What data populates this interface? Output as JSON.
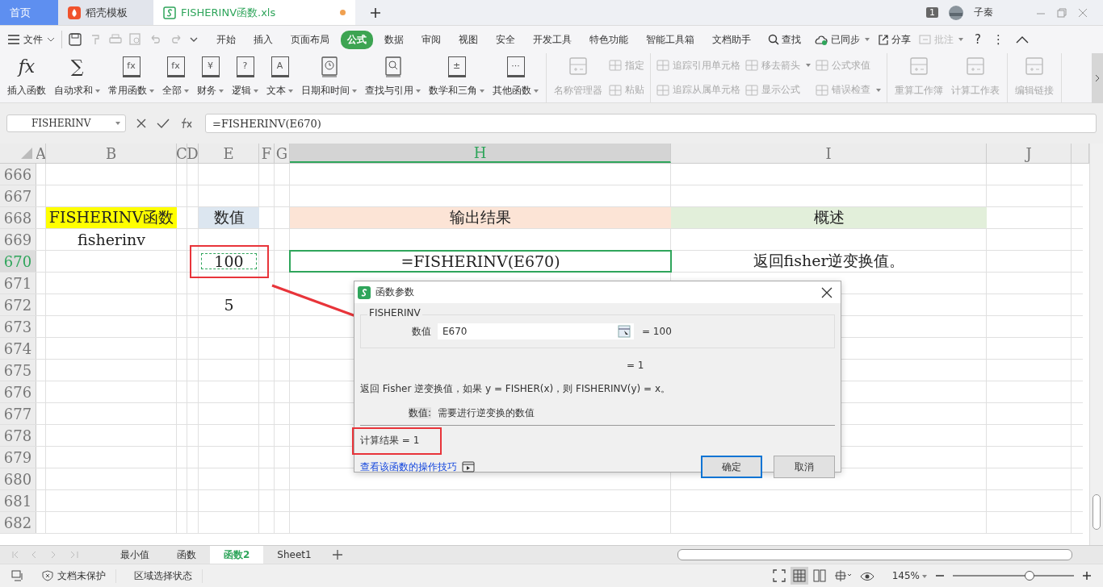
{
  "tabs": [
    {
      "label": "首页",
      "kind": "home",
      "selected": false,
      "modified": false
    },
    {
      "label": "稻壳模板",
      "kind": "docer",
      "selected": false,
      "modified": false
    },
    {
      "label": "FISHERINV函数.xls",
      "kind": "sheet",
      "selected": true,
      "modified": true
    }
  ],
  "title_bar": {
    "badge": "1",
    "user": "子秦"
  },
  "menu": {
    "file": "文件",
    "items": [
      {
        "label": "开始",
        "selected": false
      },
      {
        "label": "插入",
        "selected": false
      },
      {
        "label": "页面布局",
        "selected": false
      },
      {
        "label": "公式",
        "selected": true
      },
      {
        "label": "数据",
        "selected": false
      },
      {
        "label": "审阅",
        "selected": false
      },
      {
        "label": "视图",
        "selected": false
      },
      {
        "label": "安全",
        "selected": false
      },
      {
        "label": "开发工具",
        "selected": false
      },
      {
        "label": "特色功能",
        "selected": false
      },
      {
        "label": "智能工具箱",
        "selected": false
      },
      {
        "label": "文档助手",
        "selected": false
      }
    ],
    "search": "查找",
    "sync": "已同步",
    "share": "分享",
    "comment": {
      "label": "批注",
      "disabled": true
    },
    "help": "?",
    "more": "⋮"
  },
  "ribbon": [
    [
      {
        "kind": "glyph",
        "glyph": "fx",
        "label": "插入函数",
        "dropdown": false,
        "disabled": false
      },
      {
        "kind": "glyph",
        "glyph": "∑",
        "label": "自动求和",
        "dropdown": true,
        "disabled": false
      },
      {
        "kind": "boxed",
        "glyph": "fx",
        "label": "常用函数",
        "dropdown": true,
        "disabled": false
      },
      {
        "kind": "boxed",
        "glyph": "fx",
        "label": "全部",
        "dropdown": true,
        "disabled": false
      },
      {
        "kind": "boxed",
        "glyph": "¥",
        "label": "财务",
        "dropdown": true,
        "disabled": false
      },
      {
        "kind": "boxed",
        "glyph": "?",
        "label": "逻辑",
        "dropdown": true,
        "disabled": false
      },
      {
        "kind": "boxed",
        "glyph": "A",
        "label": "文本",
        "dropdown": true,
        "disabled": false
      },
      {
        "kind": "clock",
        "label": "日期和时间",
        "dropdown": true,
        "disabled": false
      },
      {
        "kind": "search",
        "label": "查找与引用",
        "dropdown": true,
        "disabled": false
      },
      {
        "kind": "boxed",
        "glyph": "±",
        "label": "数学和三角",
        "dropdown": true,
        "disabled": false
      },
      {
        "kind": "boxed",
        "glyph": "···",
        "label": "其他函数",
        "dropdown": true,
        "disabled": false
      }
    ],
    [
      {
        "kind": "drawn",
        "label": "名称管理器",
        "dropdown": false,
        "disabled": true
      },
      {
        "kind": "stack",
        "items": [
          {
            "label": "指定",
            "dropdown": false,
            "disabled": true
          },
          {
            "label": "粘贴",
            "dropdown": false,
            "disabled": true
          }
        ]
      }
    ],
    [
      {
        "kind": "stack",
        "items": [
          {
            "label": "追踪引用单元格",
            "dropdown": false,
            "disabled": true
          },
          {
            "label": "追踪从属单元格",
            "dropdown": false,
            "disabled": true
          }
        ]
      },
      {
        "kind": "stack",
        "items": [
          {
            "label": "移去箭头",
            "dropdown": true,
            "disabled": true
          },
          {
            "label": "显示公式",
            "dropdown": false,
            "disabled": true
          }
        ]
      },
      {
        "kind": "stack",
        "items": [
          {
            "label": "公式求值",
            "dropdown": false,
            "disabled": true
          },
          {
            "label": "错误检查",
            "dropdown": true,
            "disabled": true
          }
        ]
      }
    ],
    [
      {
        "kind": "drawn",
        "label": "重算工作簿",
        "dropdown": false,
        "disabled": true
      },
      {
        "kind": "drawn",
        "label": "计算工作表",
        "dropdown": false,
        "disabled": true
      }
    ],
    [
      {
        "kind": "drawn",
        "label": "编辑链接",
        "dropdown": false,
        "disabled": true
      }
    ]
  ],
  "name_box": "FISHERINV",
  "formula": "=FISHERINV(E670)",
  "columns": [
    {
      "label": "A",
      "selected": false
    },
    {
      "label": "B",
      "selected": false
    },
    {
      "label": "C",
      "selected": false
    },
    {
      "label": "D",
      "selected": false
    },
    {
      "label": "E",
      "selected": false
    },
    {
      "label": "F",
      "selected": false
    },
    {
      "label": "G",
      "selected": false
    },
    {
      "label": "H",
      "selected": true
    },
    {
      "label": "I",
      "selected": false
    },
    {
      "label": "J",
      "selected": false
    }
  ],
  "rows": [
    {
      "number": "666",
      "selected": false
    },
    {
      "number": "667",
      "selected": false
    },
    {
      "number": "668",
      "selected": false,
      "cells": [
        null,
        {
          "text": "FISHERINV函数",
          "kind": "filled",
          "color": "#ffff00"
        },
        null,
        null,
        {
          "text": "数值",
          "kind": "filled",
          "color": "#dce6f0"
        },
        null,
        null,
        {
          "text": "输出结果",
          "kind": "filled",
          "color": "#fce4d6"
        },
        {
          "text": "概述",
          "kind": "filled",
          "color": "#e2efda"
        },
        null
      ]
    },
    {
      "number": "669",
      "selected": false,
      "cells": [
        null,
        {
          "text": "fisherinv",
          "kind": "plain"
        },
        null,
        null,
        null,
        null,
        null,
        null,
        null,
        null
      ]
    },
    {
      "number": "670",
      "selected": true,
      "cells": [
        null,
        null,
        null,
        null,
        {
          "text": "100",
          "kind": "reference",
          "annotated": true
        },
        null,
        null,
        {
          "text": "=FISHERINV(E670)",
          "kind": "active"
        },
        {
          "text": "返回fisher逆变换值。",
          "kind": "plain"
        },
        null
      ]
    },
    {
      "number": "671",
      "selected": false
    },
    {
      "number": "672",
      "selected": false,
      "cells": [
        null,
        null,
        null,
        null,
        {
          "text": "5",
          "kind": "plain"
        },
        null,
        null,
        null,
        null,
        null
      ]
    },
    {
      "number": "673",
      "selected": false
    },
    {
      "number": "674",
      "selected": false
    },
    {
      "number": "675",
      "selected": false
    },
    {
      "number": "676",
      "selected": false
    },
    {
      "number": "677",
      "selected": false
    },
    {
      "number": "678",
      "selected": false
    },
    {
      "number": "679",
      "selected": false
    },
    {
      "number": "680",
      "selected": false
    },
    {
      "number": "681",
      "selected": false
    },
    {
      "number": "682",
      "selected": false
    }
  ],
  "dialog": {
    "title": "函数参数",
    "group": "FISHERINV",
    "arg_label": "数值",
    "arg_value": "E670",
    "arg_result": "= 100",
    "result": "= 1",
    "description": "返回 Fisher 逆变换值，如果 y = FISHER(x)，则 FISHERINV(y) = x。",
    "arg_help_label": "数值:",
    "arg_help": "需要进行逆变换的数值",
    "calc_result": "计算结果  =  1",
    "calc_annotated": true,
    "help_link": "查看该函数的操作技巧",
    "buttons": [
      {
        "label": "确定",
        "selected": true
      },
      {
        "label": "取消",
        "selected": false
      }
    ]
  },
  "sheet_tabs": [
    {
      "label": "最小值",
      "selected": false
    },
    {
      "label": "函数",
      "selected": false
    },
    {
      "label": "函数2",
      "selected": true
    },
    {
      "label": "Sheet1",
      "selected": false
    }
  ],
  "status_bar": {
    "protection": "文档未保护",
    "mode": "区域选择状态",
    "zoom": "145%",
    "zoom_level": {
      "level": 0.63
    }
  }
}
